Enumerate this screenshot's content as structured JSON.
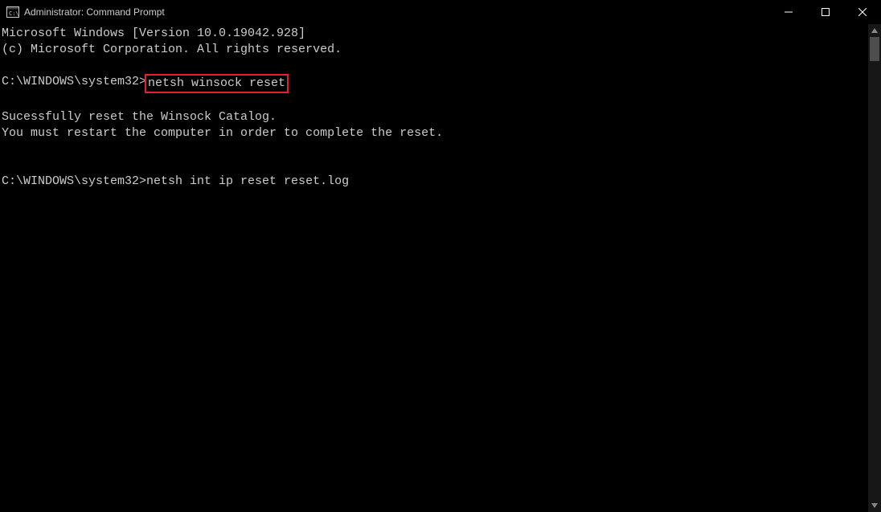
{
  "window": {
    "title": "Administrator: Command Prompt"
  },
  "terminal": {
    "banner_line1": "Microsoft Windows [Version 10.0.19042.928]",
    "banner_line2": "(c) Microsoft Corporation. All rights reserved.",
    "prompt1_path": "C:\\WINDOWS\\system32>",
    "prompt1_command": "netsh winsock reset",
    "output_line1": "Sucessfully reset the Winsock Catalog.",
    "output_line2": "You must restart the computer in order to complete the reset.",
    "prompt2_path": "C:\\WINDOWS\\system32>",
    "prompt2_command": "netsh int ip reset reset.log"
  },
  "icons": {
    "app": "cmd-icon",
    "minimize": "minimize-icon",
    "maximize": "maximize-icon",
    "close": "close-icon",
    "scroll_up": "chevron-up-icon",
    "scroll_down": "chevron-down-icon"
  }
}
